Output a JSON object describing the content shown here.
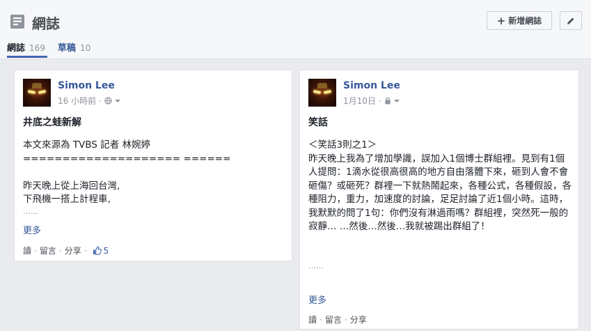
{
  "header": {
    "title": "網誌",
    "new_button": "新增網誌",
    "tabs": [
      {
        "label": "網誌",
        "count": "169"
      },
      {
        "label": "草稿",
        "count": "10"
      }
    ]
  },
  "posts": [
    {
      "author": "Simon Lee",
      "time": "16 小時前",
      "privacy_icon": "globe-icon",
      "title": "井底之蛙新解",
      "lines": [
        "本文來源為 TVBS 記者 林婉婷",
        "==================== ======",
        "",
        "昨天晚上從上海回台灣,",
        "下飛機一搭上計程車,",
        "……"
      ],
      "more": "更多",
      "actions": {
        "read": "讀",
        "comment": "留言",
        "share": "分享",
        "likes": "5"
      }
    },
    {
      "author": "Simon Lee",
      "time": "1月10日",
      "privacy_icon": "lock-icon",
      "title": "笑話",
      "lines": [
        "＜笑話3則之1＞",
        "昨天晚上我為了增加學識，誤加入1個博士群組裡。見到有1個人提問：1滴水從很高很高的地方自由落體下來，砸到人會不會砸傷？或砸死？群裡一下就熱鬧起來，各種公式，各種假設，各種阻力，重力，加速度的討論，足足討論了近1個小時。這時，我默默的問了1句：你們沒有淋過雨嗎？群組裡，突然死一般的寂靜… …然後…然後…我就被踢出群組了！",
        "",
        "",
        "……"
      ],
      "more": "更多",
      "actions": {
        "read": "讀",
        "comment": "留言",
        "share": "分享"
      }
    }
  ],
  "colors": {
    "link": "#365899",
    "muted": "#90949c",
    "accent": "#4267b2"
  }
}
